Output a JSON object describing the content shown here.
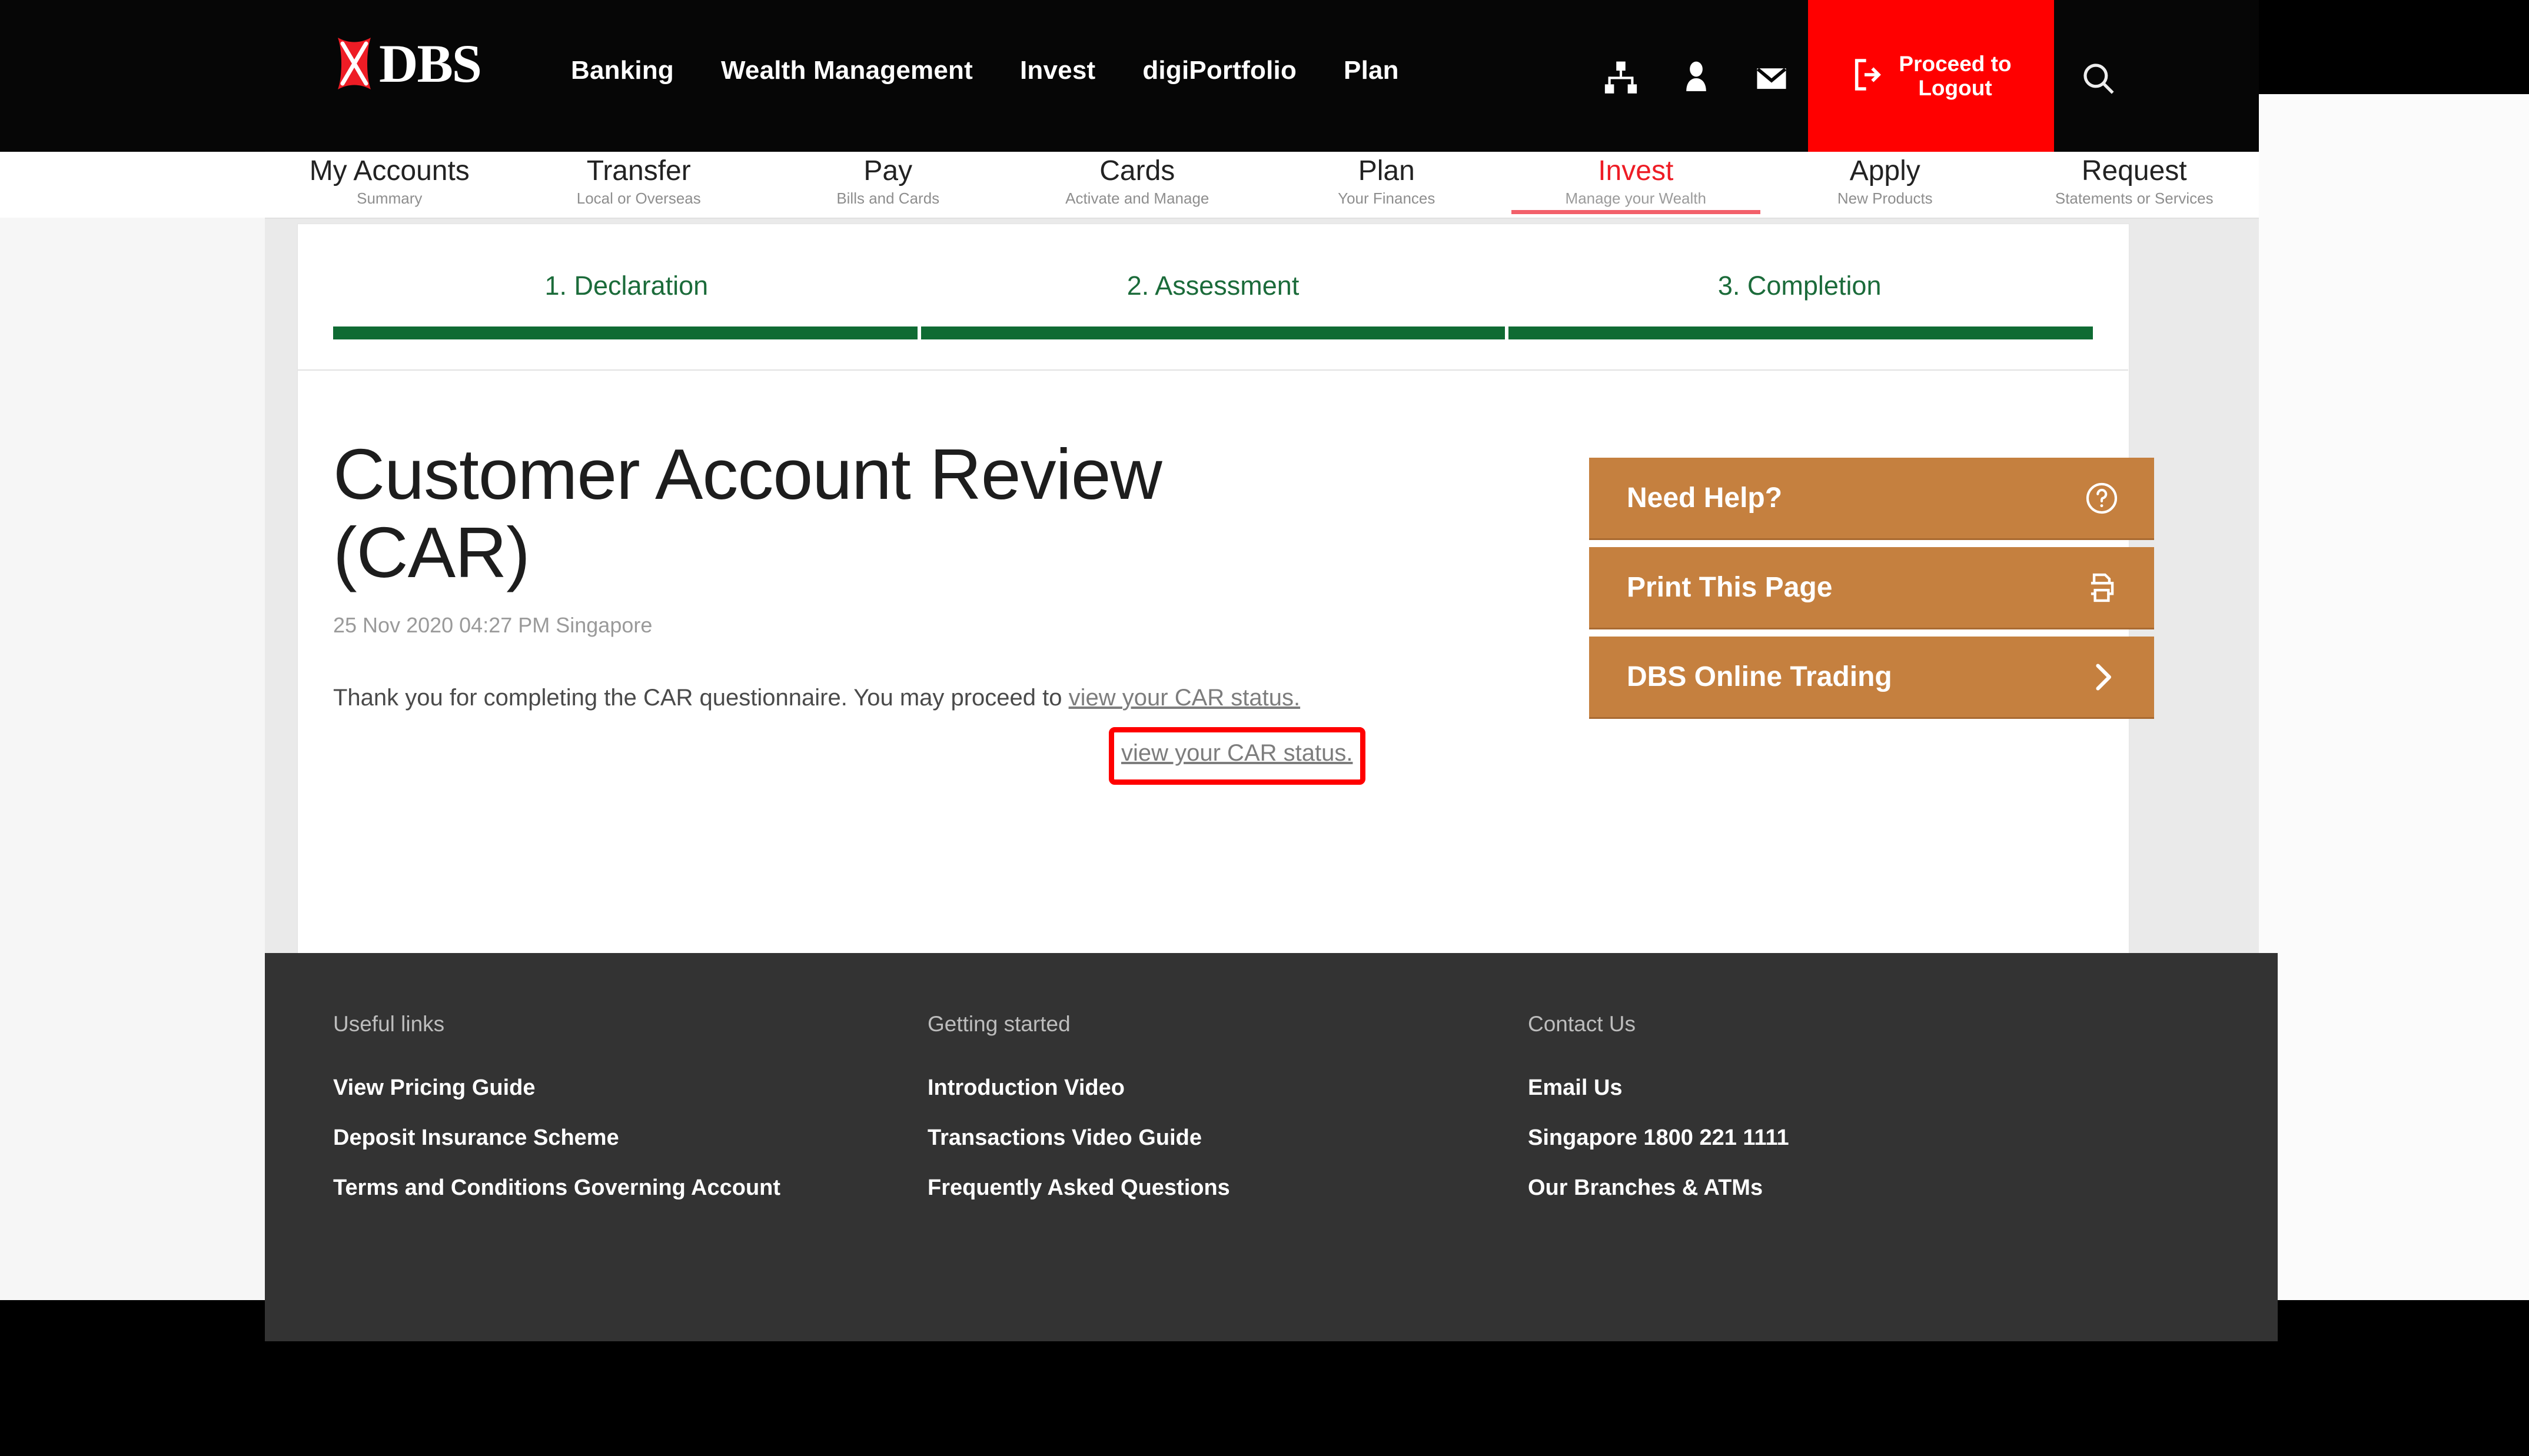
{
  "header": {
    "brand": {
      "logo_icon": "dbs-x-logo-icon",
      "wordmark": "DBS"
    },
    "nav": [
      {
        "label": "Banking"
      },
      {
        "label": "Wealth Management"
      },
      {
        "label": "Invest"
      },
      {
        "label": "digiPortfolio"
      },
      {
        "label": "Plan"
      }
    ],
    "icons": [
      {
        "name": "sitemap-icon"
      },
      {
        "name": "user-profile-icon"
      },
      {
        "name": "mail-envelope-icon"
      }
    ],
    "logout": {
      "label_line1": "Proceed to",
      "label_line2": "Logout",
      "icon": "logout-arrow-icon",
      "color": "#ff0000"
    },
    "search": {
      "icon": "search-magnifier-icon"
    }
  },
  "subnav": {
    "active_color": "#ee1c25",
    "items": [
      {
        "title": "My Accounts",
        "subtitle": "Summary",
        "active": false
      },
      {
        "title": "Transfer",
        "subtitle": "Local or Overseas",
        "active": false
      },
      {
        "title": "Pay",
        "subtitle": "Bills and Cards",
        "active": false
      },
      {
        "title": "Cards",
        "subtitle": "Activate and Manage",
        "active": false
      },
      {
        "title": "Plan",
        "subtitle": "Your Finances",
        "active": false
      },
      {
        "title": "Invest",
        "subtitle": "Manage your Wealth",
        "active": true
      },
      {
        "title": "Apply",
        "subtitle": "New Products",
        "active": false
      },
      {
        "title": "Request",
        "subtitle": "Statements or Services",
        "active": false
      }
    ]
  },
  "stepper": {
    "color": "#0f6b33",
    "steps": [
      {
        "label": "1. Declaration",
        "complete": true
      },
      {
        "label": "2. Assessment",
        "complete": true
      },
      {
        "label": "3. Completion",
        "complete": true
      }
    ]
  },
  "main": {
    "title_line1": "Customer Account Review",
    "title_line2": "(CAR)",
    "timestamp": "25 Nov 2020 04:27 PM Singapore",
    "body_prefix": "Thank you for completing the CAR questionnaire. You may proceed to ",
    "body_link": "view your CAR status.",
    "annotation": {
      "shape": "rectangle",
      "color": "#ff0000",
      "target": "view your CAR status."
    }
  },
  "side_actions": [
    {
      "label": "Need Help?",
      "icon": "question-circle-icon",
      "color": "#c5803f"
    },
    {
      "label": "Print This Page",
      "icon": "printer-icon",
      "color": "#c5803f"
    },
    {
      "label": "DBS Online Trading",
      "icon": "chevron-right-icon",
      "color": "#c5803f"
    }
  ],
  "footer": {
    "columns": [
      {
        "heading": "Useful links",
        "links": [
          "View Pricing Guide",
          "Deposit Insurance Scheme",
          "Terms and Conditions Governing Account"
        ]
      },
      {
        "heading": "Getting started",
        "links": [
          "Introduction Video",
          "Transactions Video Guide",
          "Frequently Asked Questions"
        ]
      },
      {
        "heading": "Contact Us",
        "links": [
          "Email Us",
          "Singapore 1800 221 1111",
          "Our Branches & ATMs"
        ]
      }
    ]
  }
}
